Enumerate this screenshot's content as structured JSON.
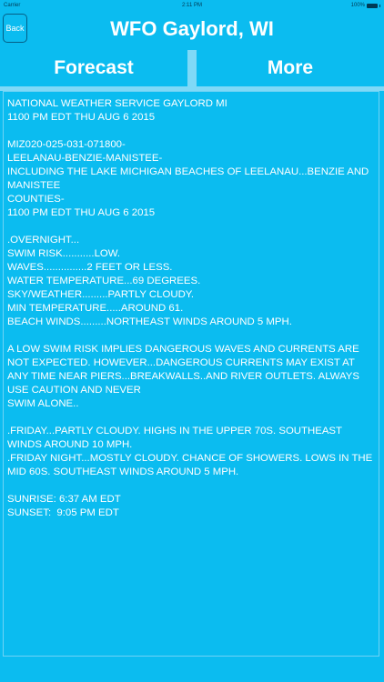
{
  "status_bar": {
    "carrier": "Carrier",
    "time": "2:11 PM",
    "battery": "100%"
  },
  "nav": {
    "back_label": "Back",
    "title": "WFO Gaylord, WI"
  },
  "tabs": [
    {
      "label": "Forecast"
    },
    {
      "label": "More"
    }
  ],
  "forecast": {
    "text": "NATIONAL WEATHER SERVICE GAYLORD MI\n1100 PM EDT THU AUG 6 2015\n\nMIZ020-025-031-071800-\nLEELANAU-BENZIE-MANISTEE-\nINCLUDING THE LAKE MICHIGAN BEACHES OF LEELANAU...BENZIE AND MANISTEE\nCOUNTIES-\n1100 PM EDT THU AUG 6 2015\n\n.OVERNIGHT...\nSWIM RISK...........LOW.\nWAVES...............2 FEET OR LESS.\nWATER TEMPERATURE...69 DEGREES.\nSKY/WEATHER.........PARTLY CLOUDY.\nMIN TEMPERATURE.....AROUND 61.\nBEACH WINDS.........NORTHEAST WINDS AROUND 5 MPH.\n\nA LOW SWIM RISK IMPLIES DANGEROUS WAVES AND CURRENTS ARE NOT EXPECTED. HOWEVER...DANGEROUS CURRENTS MAY EXIST AT ANY TIME NEAR PIERS...BREAKWALLS..AND RIVER OUTLETS. ALWAYS USE CAUTION AND NEVER\nSWIM ALONE..\n\n.FRIDAY...PARTLY CLOUDY. HIGHS IN THE UPPER 70S. SOUTHEAST WINDS AROUND 10 MPH.\n.FRIDAY NIGHT...MOSTLY CLOUDY. CHANCE OF SHOWERS. LOWS IN THE MID 60S. SOUTHEAST WINDS AROUND 5 MPH.\n\nSUNRISE: 6:37 AM EDT\nSUNSET:  9:05 PM EDT"
  },
  "colors": {
    "background": "#0bbcf0",
    "separator": "#7fd9f7",
    "text": "#ffffff"
  }
}
